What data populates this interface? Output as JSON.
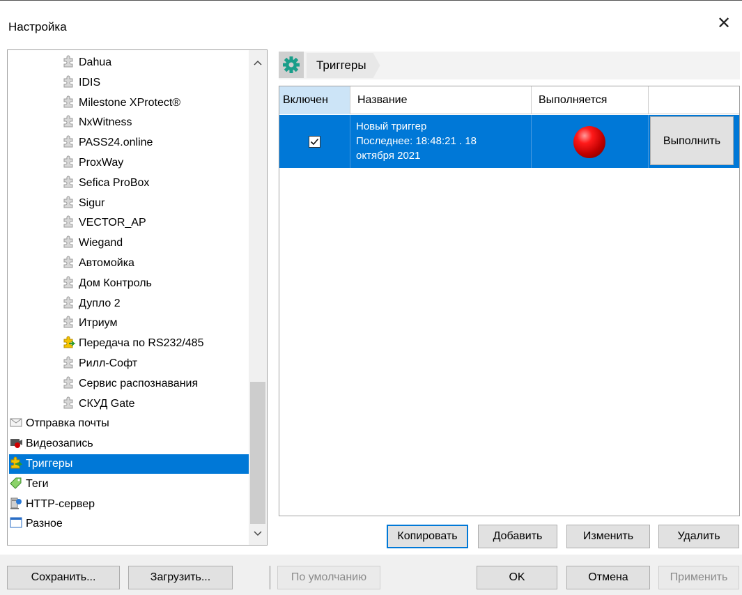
{
  "window": {
    "title": "Настройка",
    "close_glyph": "✕"
  },
  "tree": {
    "items": [
      {
        "label": "Dahua",
        "icon": "puzzle-gray-icon",
        "indent": 2
      },
      {
        "label": "IDIS",
        "icon": "puzzle-gray-icon",
        "indent": 2
      },
      {
        "label": "Milestone XProtect®",
        "icon": "puzzle-gray-icon",
        "indent": 2
      },
      {
        "label": "NxWitness",
        "icon": "puzzle-gray-icon",
        "indent": 2
      },
      {
        "label": "PASS24.online",
        "icon": "puzzle-gray-icon",
        "indent": 2
      },
      {
        "label": "ProxWay",
        "icon": "puzzle-gray-icon",
        "indent": 2
      },
      {
        "label": "Sefica ProBox",
        "icon": "puzzle-gray-icon",
        "indent": 2
      },
      {
        "label": "Sigur",
        "icon": "puzzle-gray-icon",
        "indent": 2
      },
      {
        "label": "VECTOR_AP",
        "icon": "puzzle-gray-icon",
        "indent": 2
      },
      {
        "label": "Wiegand",
        "icon": "puzzle-gray-icon",
        "indent": 2
      },
      {
        "label": "Автомойка",
        "icon": "puzzle-gray-icon",
        "indent": 2
      },
      {
        "label": "Дом Контроль",
        "icon": "puzzle-gray-icon",
        "indent": 2
      },
      {
        "label": "Дупло 2",
        "icon": "puzzle-gray-icon",
        "indent": 2
      },
      {
        "label": "Итриум",
        "icon": "puzzle-gray-icon",
        "indent": 2
      },
      {
        "label": "Передача по RS232/485",
        "icon": "puzzle-yellow-icon",
        "indent": 2
      },
      {
        "label": "Рилл-Софт",
        "icon": "puzzle-gray-icon",
        "indent": 2
      },
      {
        "label": "Сервис распознавания",
        "icon": "puzzle-gray-icon",
        "indent": 2
      },
      {
        "label": "СКУД Gate",
        "icon": "puzzle-gray-icon",
        "indent": 2
      },
      {
        "label": "Отправка почты",
        "icon": "envelope-icon",
        "indent": 0
      },
      {
        "label": "Видеозапись",
        "icon": "video-record-icon",
        "indent": 0
      },
      {
        "label": "Триггеры",
        "icon": "trigger-icon",
        "indent": 0,
        "selected": true
      },
      {
        "label": "Теги",
        "icon": "tag-icon",
        "indent": 0
      },
      {
        "label": "HTTP-сервер",
        "icon": "server-icon",
        "indent": 0
      },
      {
        "label": "Разное",
        "icon": "window-icon",
        "indent": 0
      }
    ],
    "scroll_up_glyph": "^",
    "scroll_down_glyph": "v"
  },
  "section": {
    "title": "Триггеры",
    "icon": "gear-icon"
  },
  "grid": {
    "columns": [
      "Включен",
      "Название",
      "Выполняется",
      ""
    ],
    "rows": [
      {
        "enabled": true,
        "name_line1": "Новый триггер",
        "name_line2": "Последнее: 18:48:21 . 18",
        "name_line3": "октября 2021",
        "status_color": "#d00000",
        "action_label": "Выполнить"
      }
    ]
  },
  "actions": {
    "copy": "Копировать",
    "add": "Добавить",
    "edit": "Изменить",
    "delete": "Удалить"
  },
  "footer": {
    "save": "Сохранить...",
    "load": "Загрузить...",
    "defaults": "По умолчанию",
    "ok": "OK",
    "cancel": "Отмена",
    "apply": "Применить"
  },
  "colors": {
    "selection": "#0078d7",
    "header_active": "#cce4f7"
  }
}
